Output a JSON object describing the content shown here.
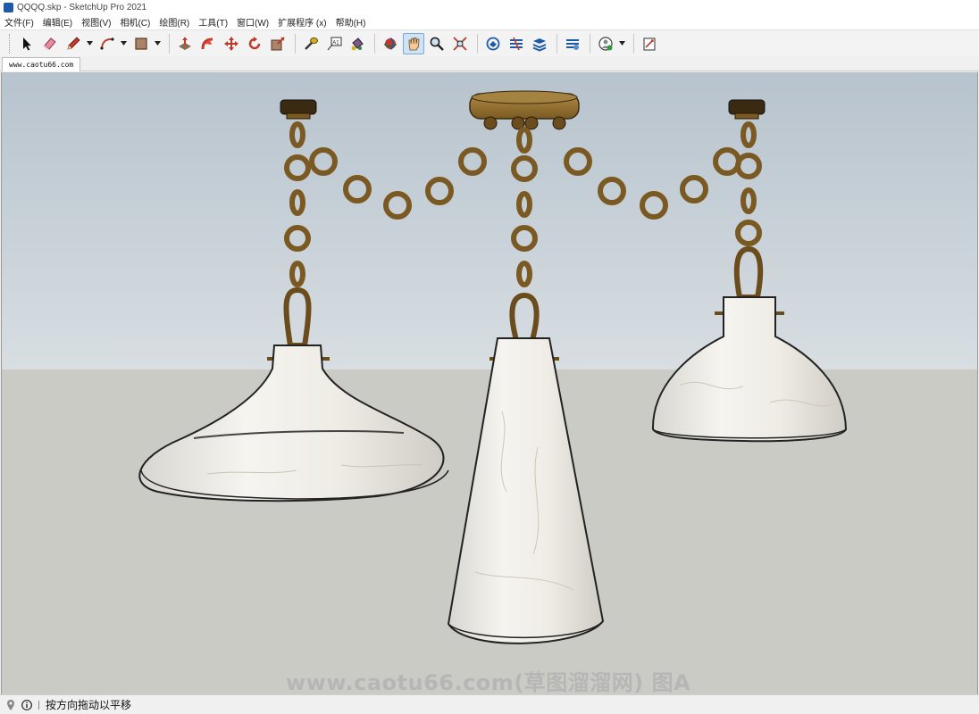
{
  "window": {
    "title": "QQQQ.skp - SketchUp Pro 2021"
  },
  "menu": [
    "文件(F)",
    "编辑(E)",
    "视图(V)",
    "相机(C)",
    "绘图(R)",
    "工具(T)",
    "窗口(W)",
    "扩展程序 (x)",
    "帮助(H)"
  ],
  "toolbar": {
    "tools": [
      "select-icon",
      "eraser-icon",
      "pencil-icon",
      "arc-icon",
      "rectangle-icon",
      "push-pull-icon",
      "follow-me-icon",
      "move-icon",
      "rotate-icon",
      "scale-icon",
      "tape-measure-icon",
      "text-icon",
      "paint-bucket-icon",
      "orbit-icon",
      "pan-icon",
      "zoom-icon",
      "zoom-extents-icon",
      "warehouse-icon",
      "extension-warehouse-icon",
      "layout-icon",
      "extension-manager-icon",
      "profile-icon",
      "addlocation-icon"
    ],
    "active_tool": "pan-icon"
  },
  "scene_tab": {
    "label": "www.caotu66.com"
  },
  "viewport": {
    "sky_color": "#c5cfd7",
    "ground_color": "#cbcbc5",
    "watermark": "www.caotu66.com(草图溜溜网) 图A"
  },
  "status": {
    "message": "按方向拖动以平移"
  }
}
